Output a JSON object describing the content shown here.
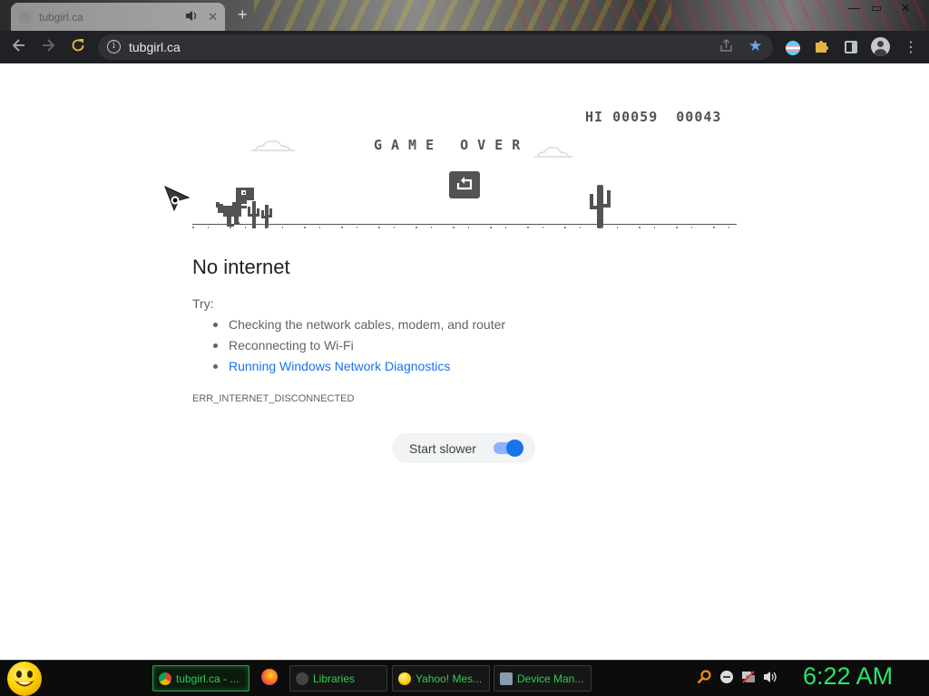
{
  "browser": {
    "tab": {
      "title": "tubgirl.ca",
      "close_glyph": "✕",
      "audio_icon": "speaker-icon"
    },
    "new_tab_glyph": "+",
    "window_controls": {
      "minimize": "—",
      "restore": "▭",
      "close": "✕"
    },
    "url": "tubgirl.ca",
    "toolbar_icons": [
      "back-icon",
      "forward-icon",
      "reload-icon",
      "site-info-icon",
      "share-icon",
      "bookmark-star-icon",
      "trans-flag-extension-icon",
      "extensions-puzzle-icon",
      "side-panel-icon",
      "profile-avatar-icon",
      "menu-kebab-icon"
    ],
    "colors": {
      "toolbar": "#202124",
      "omnibox": "#303134",
      "star": "#6ea4f0",
      "puzzle": "#e2b542",
      "reload": "#e2b542"
    }
  },
  "game": {
    "hi_label": "HI",
    "hi_score": "00059",
    "current_score": "00043",
    "game_over": "GAME OVER",
    "sprite_names": [
      "t-rex-icon",
      "cactus-icon",
      "cloud-icon",
      "restart-icon"
    ],
    "ink_color": "#535353"
  },
  "error": {
    "heading": "No internet",
    "try_label": "Try:",
    "suggestions": [
      "Checking the network cables, modem, and router",
      "Reconnecting to Wi-Fi",
      "Running Windows Network Diagnostics"
    ],
    "code": "ERR_INTERNET_DISCONNECTED",
    "link_color": "#1a73e8"
  },
  "settings": {
    "start_slower_label": "Start slower",
    "start_slower_on": true
  },
  "taskbar": {
    "start_icon": "smiley-start-icon",
    "tasks": [
      {
        "label": "tubgirl.ca - ...",
        "icon": "chrome-icon",
        "active": true
      },
      {
        "label": "",
        "icon": "firefox-icon",
        "active": false
      },
      {
        "label": "Libraries",
        "icon": "libraries-icon",
        "active": false
      },
      {
        "label": "Yahoo! Mes...",
        "icon": "yahoo-messenger-icon",
        "active": false
      },
      {
        "label": "Device Man...",
        "icon": "device-manager-icon",
        "active": false
      }
    ],
    "tray_icons": [
      "search-icon",
      "notification-icon",
      "network-icon",
      "volume-icon"
    ],
    "clock": "6:22 AM",
    "accent": "#27e66b"
  }
}
